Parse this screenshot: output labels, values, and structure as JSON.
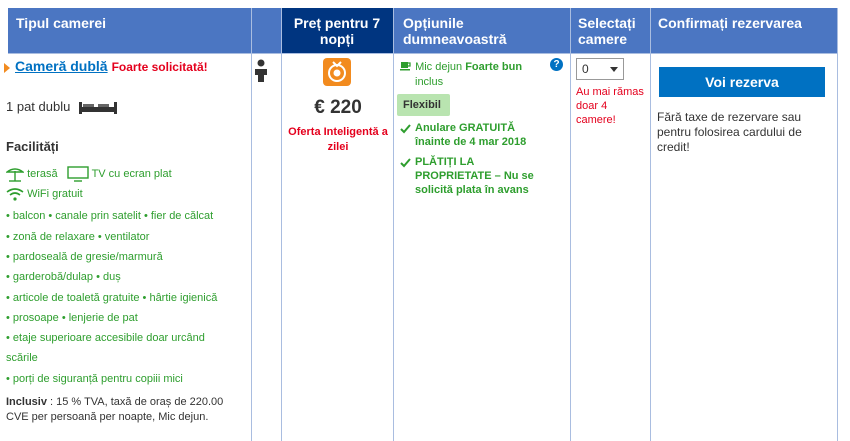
{
  "header": {
    "room_type": "Tipul camerei",
    "price": "Preț pentru 7 nopți",
    "options": "Opțiunile dumneavoastră",
    "select": "Selectați camere",
    "confirm": "Confirmați rezervarea"
  },
  "room": {
    "name": "Cameră dublă",
    "badge": "Foarte solicitată!",
    "bed": "1 pat dublu"
  },
  "facilities": {
    "title": "Facilități",
    "row1_a": "terasă",
    "row1_b": "TV cu ecran plat",
    "row2": "WiFi gratuit",
    "lines": [
      "• balcon  • canale prin satelit  • fier de călcat",
      "• zonă de relaxare  • ventilator",
      "• pardoseală de gresie/marmură",
      "• garderobă/dulap  • duș",
      "• articole de toaletă gratuite  • hârtie igienică",
      "• prosoape  • lenjerie de pat",
      "• etaje superioare accesibile doar urcând",
      "scările",
      "• porți de siguranță pentru copiii mici"
    ],
    "included_label": "Inclusiv",
    "included_text": " : 15 % TVA, taxă de oraș de 220.00 CVE per persoană per noapte, Mic dejun."
  },
  "price": {
    "value": "€ 220",
    "smart_offer": "Oferta Inteligentă a zilei"
  },
  "options": {
    "breakfast": "Mic dejun",
    "breakfast_quality": "Foarte bun",
    "breakfast_included": "inclus",
    "help": "?",
    "flex": "Flexibil",
    "cancel": "Anulare GRATUITĂ înainte de 4 mar 2018",
    "pay": "PLĂTIȚI LA PROPRIETATE – Nu se solicită plata în avans"
  },
  "select": {
    "value": "0",
    "warning": "Au mai rămas doar 4 camere!"
  },
  "confirm": {
    "button": "Voi rezerva",
    "note": "Fără taxe de rezervare sau pentru folosirea cardului de credit!"
  },
  "colors": {
    "header_bg": "#4b76c2",
    "price_header_bg": "#003580",
    "button_bg": "#0071c2",
    "green": "#2e9e2e",
    "red": "#e4001d",
    "accent_orange": "#f28b1f"
  }
}
